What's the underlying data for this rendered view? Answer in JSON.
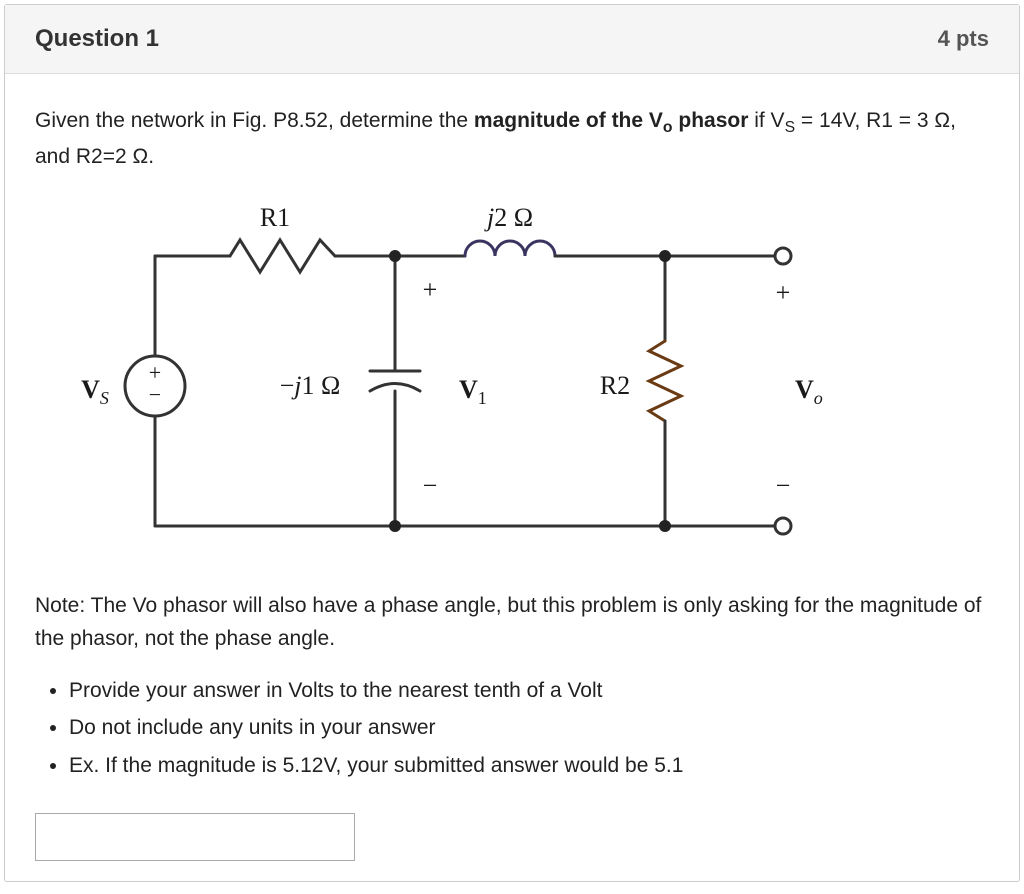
{
  "header": {
    "title": "Question 1",
    "points": "4 pts"
  },
  "prompt": {
    "lead": "Given the network in Fig. P8.52, determine the ",
    "bold_part_pre": "magnitude of the V",
    "bold_sub": "o",
    "bold_part_post": " phasor",
    "trail_pre": " if V",
    "trail_sub": "S",
    "trail_post": " = 14V, R1 = 3 Ω, and R2=2 Ω."
  },
  "diagram": {
    "r1_label": "R1",
    "ind_label_j": "j",
    "ind_label_val": "2 Ω",
    "vs_label": "V",
    "vs_sub": "S",
    "cap_label_mj": "−j1 Ω",
    "v1_label": "V",
    "v1_sub": "1",
    "r2_label": "R2",
    "vo_label": "V",
    "vo_sub": "o",
    "plus": "+",
    "minus": "−"
  },
  "note": "Note: The Vo phasor will also have a phase angle, but this problem is only asking for the magnitude of the phasor, not the phase angle.",
  "instructions": [
    "Provide your answer in Volts to the nearest tenth of a Volt",
    "Do not include any units in your answer",
    "Ex. If the magnitude is 5.12V, your submitted answer would be 5.1"
  ],
  "answer_value": ""
}
